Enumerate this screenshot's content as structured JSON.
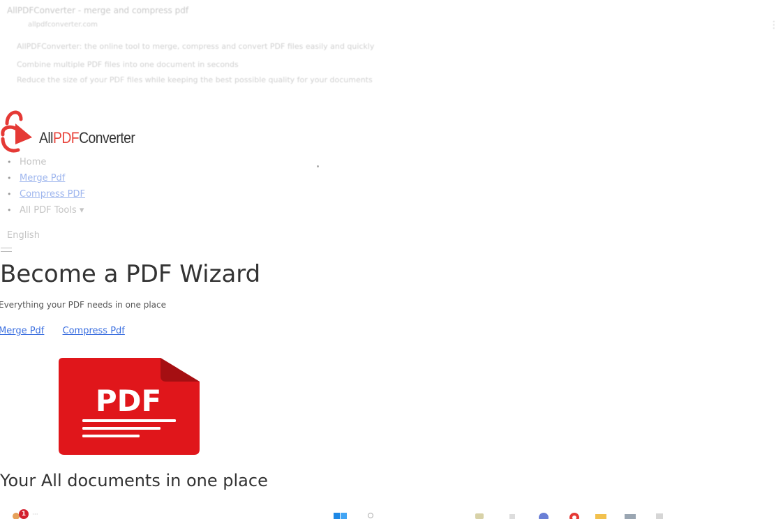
{
  "faint_header": {
    "line1": "AllPDFConverter - merge and compress pdf",
    "line2": "allpdfconverter.com",
    "line3": "AllPDFConverter: the online tool to merge, compress and convert PDF files easily and quickly",
    "line4": "Combine multiple PDF files into one document in seconds",
    "line5": "Reduce the size of your PDF files while keeping the best possible quality for your documents",
    "right_mark": "⋮"
  },
  "brand": {
    "name_prefix": "All",
    "name_pdf": "PDF",
    "name_suffix": "Converter"
  },
  "nav": {
    "items": [
      {
        "label": "Home"
      },
      {
        "label": "Merge Pdf"
      },
      {
        "label": "Compress PDF"
      },
      {
        "label": "All PDF Tools ▾"
      }
    ]
  },
  "language": "English",
  "hero": {
    "title": "Become a PDF Wizard",
    "subtitle": "Everything your PDF needs in one place",
    "links": [
      "Merge Pdf",
      "Compress Pdf"
    ]
  },
  "pdf_art": {
    "label": "PDF",
    "color": "#e0161b",
    "fold_color": "#a50f12"
  },
  "section_title": "Your All documents in one place",
  "taskbar": {
    "notification_count": "1"
  }
}
